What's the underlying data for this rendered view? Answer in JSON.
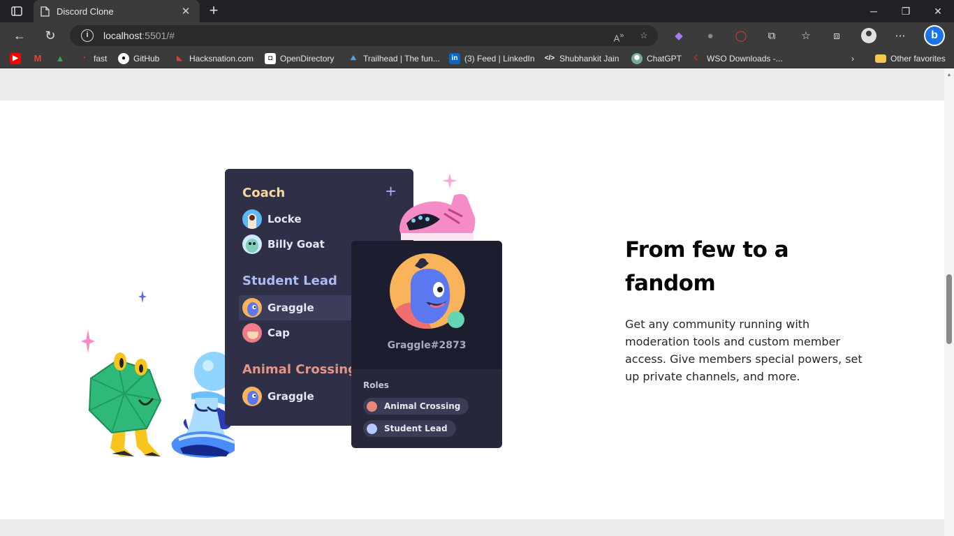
{
  "browser": {
    "tab_title": "Discord Clone",
    "url_host": "localhost",
    "url_rest": ":5501/#",
    "bookmarks": [
      {
        "label": "",
        "icon": "youtube-icon",
        "color": "#ff0000"
      },
      {
        "label": "",
        "icon": "gmail-icon",
        "color": "#ea4335"
      },
      {
        "label": "",
        "icon": "drive-icon",
        "color": "#34a853"
      },
      {
        "label": "fast",
        "icon": "fast-icon",
        "color": "#d93025"
      },
      {
        "label": "GitHub",
        "icon": "github-icon",
        "color": "#ffffff"
      },
      {
        "label": "Hacksnation.com",
        "icon": "hacksnation-icon",
        "color": "#e53935"
      },
      {
        "label": "OpenDirectory",
        "icon": "opendirectory-icon",
        "color": "#ffffff"
      },
      {
        "label": "Trailhead | The fun...",
        "icon": "trailhead-icon",
        "color": "#5aa0d8"
      },
      {
        "label": "(3) Feed | LinkedIn",
        "icon": "linkedin-icon",
        "color": "#0a66c2"
      },
      {
        "label": "Shubhankit Jain",
        "icon": "code-icon",
        "color": "#ffffff"
      },
      {
        "label": "ChatGPT",
        "icon": "chatgpt-icon",
        "color": "#74aa9c"
      },
      {
        "label": "WSO Downloads -...",
        "icon": "wso-icon",
        "color": "#c62828"
      }
    ],
    "other_favorites": "Other favorites"
  },
  "panel": {
    "groups": [
      {
        "title": "Coach",
        "color": "#f5d8a0",
        "members": [
          "Locke",
          "Billy Goat"
        ]
      },
      {
        "title": "Student Lead",
        "color": "#a8bdf5",
        "members": [
          "Graggle",
          "Cap"
        ]
      },
      {
        "title": "Animal Crossing",
        "color": "#e69483",
        "members": [
          "Graggle"
        ]
      }
    ]
  },
  "profile_card": {
    "username": "Graggle#2873",
    "roles_label": "Roles",
    "roles": [
      {
        "name": "Animal Crossing",
        "color": "#e8877a"
      },
      {
        "name": "Student Lead",
        "color": "#b5c9ff"
      }
    ]
  },
  "feature": {
    "headline": "From few to a fandom",
    "body": "Get any community running with moderation tools and custom member access. Give members special powers, set up private channels, and more."
  }
}
